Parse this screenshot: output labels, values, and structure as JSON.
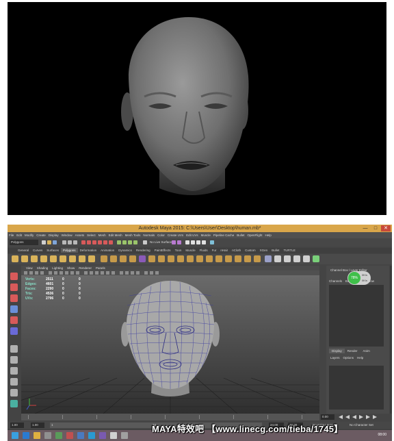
{
  "maya": {
    "title": "Autodesk Maya 2015: C:\\Users\\User\\Desktop\\human.mb*",
    "window_buttons": [
      "—",
      "□",
      "✕"
    ],
    "menu": [
      "File",
      "Edit",
      "Modify",
      "Create",
      "Display",
      "Window",
      "Assets",
      "Select",
      "Mesh",
      "Edit Mesh",
      "Mesh Tools",
      "Normals",
      "Color",
      "Create UVs",
      "Edit UVs",
      "Muscle",
      "Pipeline Cache",
      "Bullet",
      "OpenFlight",
      "Help"
    ],
    "mode": "Polygons",
    "no_live_surface": "No Live Surface",
    "shelf_tabs": [
      "General",
      "Curves",
      "Surfaces",
      "Polygons",
      "Deformation",
      "Animation",
      "Dynamics",
      "Rendering",
      "PaintEffects",
      "Toon",
      "Muscle",
      "Fluids",
      "Fur",
      "nHair",
      "nCloth",
      "Custom",
      "XGen",
      "Bullet",
      "TURTLE"
    ],
    "active_shelf": "Polygons",
    "viewport_menu": [
      "View",
      "Shading",
      "Lighting",
      "Show",
      "Renderer",
      "Panels"
    ],
    "hud": [
      {
        "label": "Verts:",
        "v1": "2511",
        "v2": "0",
        "v3": "0"
      },
      {
        "label": "Edges:",
        "v1": "4601",
        "v2": "0",
        "v3": "0"
      },
      {
        "label": "Faces:",
        "v1": "2290",
        "v2": "0",
        "v3": "0"
      },
      {
        "label": "Tris:",
        "v1": "4536",
        "v2": "0",
        "v3": "0"
      },
      {
        "label": "UVs:",
        "v1": "2796",
        "v2": "0",
        "v3": "0"
      }
    ],
    "channel_box": {
      "header": "Channel Box / Layer Editor",
      "tabs": [
        "Channels",
        "Edit",
        "Object",
        "Show"
      ],
      "badge_percent": "78%",
      "badge_line1": "0K/s",
      "badge_line2": "0K/s",
      "layer_tabs": [
        "Display",
        "Render",
        "Anim"
      ],
      "layer_menu": [
        "Layers",
        "Options",
        "Help"
      ]
    },
    "timeslider": {
      "current": "0.00"
    },
    "range": {
      "start": "1.00",
      "inner_start": "1.00",
      "frame": "1",
      "range_end_marker": "24",
      "end": "24.00",
      "total_end": "48.00",
      "anim_layer": "No Anim Layer",
      "char_set": "No Character Set"
    },
    "command": {
      "label": "MEL"
    },
    "help_line": "Move Tool: Select an object to move."
  },
  "taskbar": {
    "time": "08:00"
  },
  "watermark": "MAYA特效吧 【www.linecg.com/tieba/1745】",
  "colors": {
    "titlebar": "#d9a64a",
    "maya_bg": "#444444",
    "hud_text": "#88e0c8",
    "wire": "#3a3aa0",
    "badge_green": "#3fbf4a"
  }
}
